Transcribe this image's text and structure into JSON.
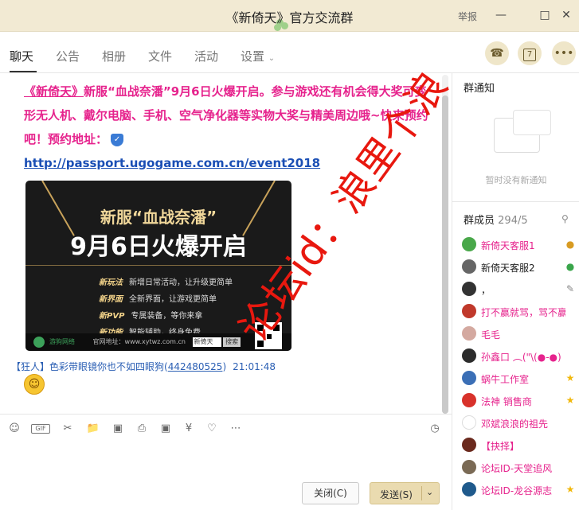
{
  "window": {
    "title": "《新倚天》官方交流群",
    "report_label": "举报",
    "minimize_icon": "minimize-icon",
    "maximize_icon": "maximize-icon",
    "close_icon": "close-icon"
  },
  "tabs": [
    {
      "label": "聊天",
      "active": true
    },
    {
      "label": "公告"
    },
    {
      "label": "相册"
    },
    {
      "label": "文件"
    },
    {
      "label": "活动"
    },
    {
      "label": "设置"
    }
  ],
  "header_buttons": [
    "phone-icon",
    "calendar-icon",
    "more-icon"
  ],
  "calendar_day": "7",
  "announcement": {
    "game": "《新倚天》",
    "text": "新服“血战奈潘”9月6日火爆开启。参与游戏还有机会得大奖可变形无人机、戴尔电脑、手机、空气净化器等实物大奖与精美周边哦~快来预约吧！预约地址：",
    "link": "http://passport.ugogame.com.cn/event2018"
  },
  "banner": {
    "title": "新服“血战奈潘”",
    "headline": "9月6日火爆开启",
    "features": [
      {
        "name": "新玩法",
        "desc": "新增日常活动，让升级更简单"
      },
      {
        "name": "新界面",
        "desc": "全新界面，让游戏更简单"
      },
      {
        "name": "新PVP",
        "desc": "专属装备，等你来拿"
      },
      {
        "name": "新功能",
        "desc": "智能辅助，终身免费"
      }
    ],
    "brand": "游狗网络",
    "site": "官网地址：www.xytwz.com.cn",
    "search_box": "新倚天",
    "search_button": "搜索"
  },
  "message": {
    "tag": "【狂人】",
    "nickname": "色彩带眼镜你也不如四眼狗",
    "qq": "442480525",
    "time": "21:01:48"
  },
  "toolbar_icons": [
    "emoji-icon",
    "gif-icon",
    "scissors-icon",
    "folder-icon",
    "image-icon",
    "print-icon",
    "gift-icon",
    "red-packet-icon",
    "bell-icon",
    "more-tool-icon",
    "history-clock-icon"
  ],
  "gif_label": "GIF",
  "buttons": {
    "close": "关闭(C)",
    "send": "发送(S)"
  },
  "sidebar": {
    "notice_title": "群通知",
    "notice_empty": "暂时没有新通知",
    "members_title": "群成员",
    "members_count": "294/5",
    "members": [
      {
        "name": "新倚天客服1",
        "color": "#e6238d",
        "badge": "admin-icon"
      },
      {
        "name": "新倚天客服2",
        "color": "#222222",
        "badge": "admin-icon"
      },
      {
        "name": "，",
        "color": "#222222",
        "badge": "edit-icon"
      },
      {
        "name": "打不赢就骂，骂不赢",
        "color": "#e6238d",
        "badge": ""
      },
      {
        "name": "毛毛",
        "color": "#e6238d",
        "badge": ""
      },
      {
        "name": "孙鑫口 ︵(\"\\(●-●)",
        "color": "#e6238d",
        "badge": ""
      },
      {
        "name": "蜗牛工作室",
        "color": "#e6238d",
        "badge": "star-icon"
      },
      {
        "name": "法神 销售商",
        "color": "#e6238d",
        "badge": "star-icon"
      },
      {
        "name": "邓斌浪浪的祖先",
        "color": "#e6238d",
        "badge": ""
      },
      {
        "name": "【抉择】",
        "color": "#e6238d",
        "badge": ""
      },
      {
        "name": "论坛ID-天堂追风",
        "color": "#e6238d",
        "badge": ""
      },
      {
        "name": "论坛ID-龙谷源志",
        "color": "#e6238d",
        "badge": "star-icon"
      }
    ]
  },
  "watermark": "论坛id：浪里个浪",
  "colors": {
    "titlebar": "#f2ead3",
    "accent_pink": "#e6238d",
    "link_blue": "#1b4fb5",
    "send_button": "#eadbb0",
    "watermark_red": "#e8180f"
  }
}
